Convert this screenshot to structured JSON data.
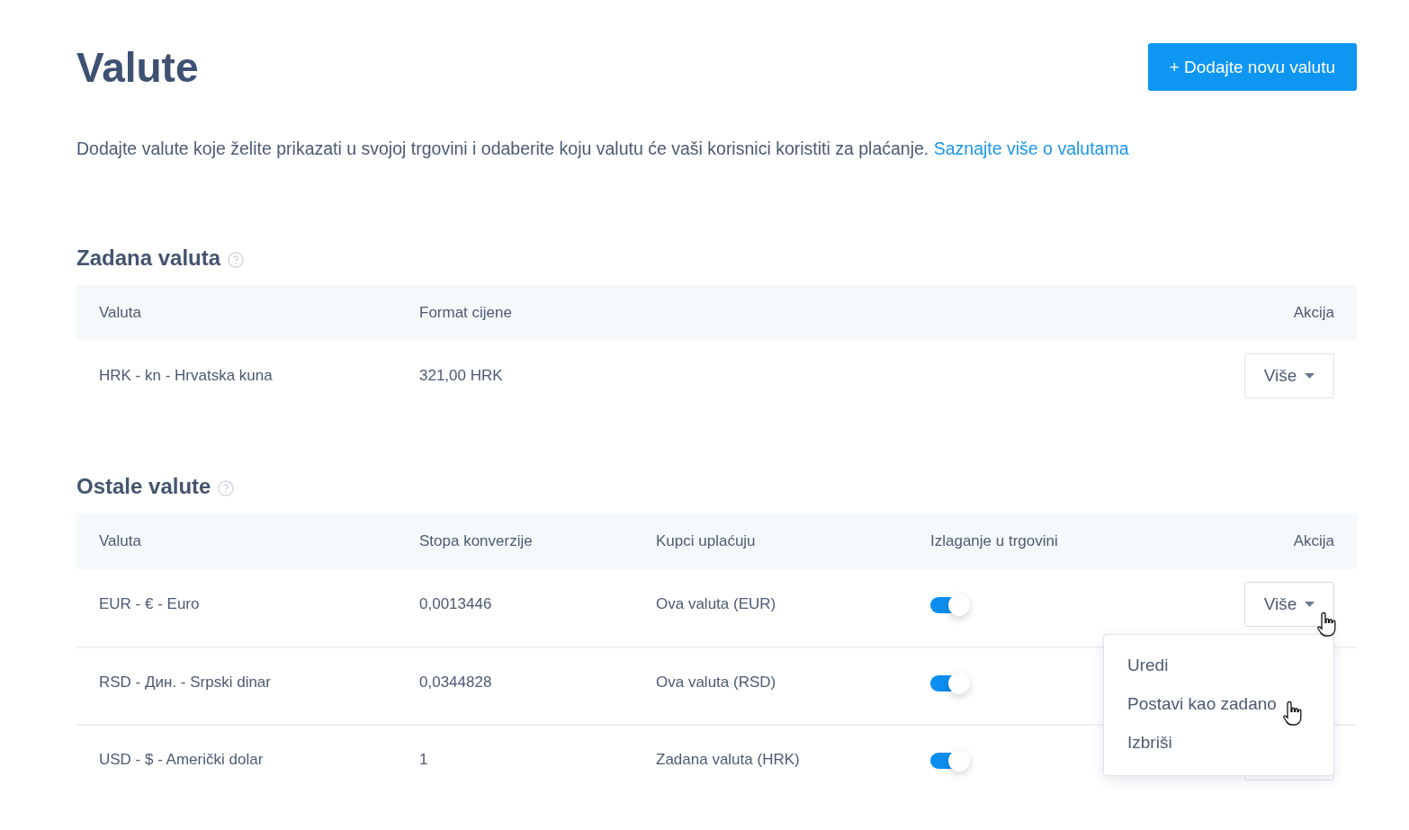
{
  "title": "Valute",
  "add_button": "+ Dodajte novu valutu",
  "description": {
    "text": "Dodajte valute koje želite prikazati u svojoj trgovini i odaberite koju valutu će vaši korisnici koristiti za plaćanje.",
    "link": "Saznajte više o valutama"
  },
  "default_section": {
    "heading": "Zadana valuta",
    "columns": [
      "Valuta",
      "Format cijene",
      "Akcija"
    ],
    "rows": [
      {
        "currency": "HRK - kn - Hrvatska kuna",
        "price_format": "321,00 HRK",
        "action": "Više"
      }
    ]
  },
  "other_section": {
    "heading": "Ostale valute",
    "columns": [
      "Valuta",
      "Stopa konverzije",
      "Kupci uplaćuju",
      "Izlaganje u trgovini",
      "Akcija"
    ],
    "rows": [
      {
        "currency": "EUR - € - Euro",
        "rate": "0,0013446",
        "customers_pay": "Ova valuta (EUR)",
        "shown_in_store": true,
        "action": "Više",
        "menu_open": true
      },
      {
        "currency": "RSD - Дин. - Srpski dinar",
        "rate": "0,0344828",
        "customers_pay": "Ova valuta (RSD)",
        "shown_in_store": true,
        "menu_open": false
      },
      {
        "currency": "USD - $ - Američki dolar",
        "rate": "1",
        "customers_pay": "Zadana valuta (HRK)",
        "shown_in_store": true,
        "menu_open": false
      }
    ],
    "menu": {
      "items": [
        "Uredi",
        "Postavi kao zadano",
        "Izbriši"
      ]
    }
  }
}
